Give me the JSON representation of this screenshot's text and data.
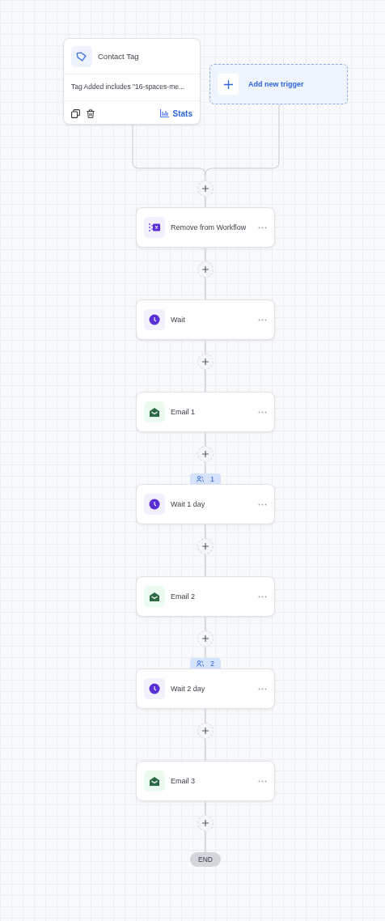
{
  "trigger": {
    "title": "Contact Tag",
    "description": "Tag Added includes \"16-spaces-me...",
    "stats_label": "Stats"
  },
  "add_trigger": {
    "label": "Add new trigger"
  },
  "steps": [
    {
      "kind": "remove",
      "title": "Remove from Workflow"
    },
    {
      "kind": "wait",
      "title": "Wait"
    },
    {
      "kind": "email",
      "title": "Email 1"
    },
    {
      "kind": "wait",
      "title": "Wait 1 day",
      "count": "1"
    },
    {
      "kind": "email",
      "title": "Email 2"
    },
    {
      "kind": "wait",
      "title": "Wait 2 day",
      "count": "2"
    },
    {
      "kind": "email",
      "title": "Email 3"
    }
  ],
  "end": {
    "label": "END"
  }
}
